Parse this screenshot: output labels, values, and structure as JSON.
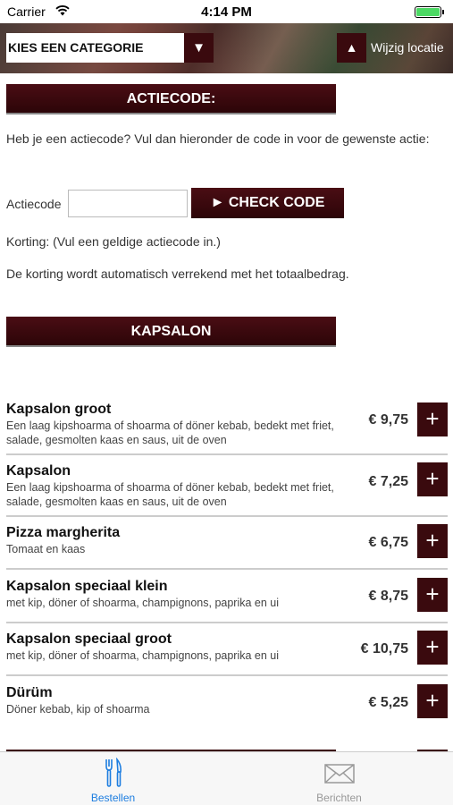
{
  "status_bar": {
    "carrier": "Carrier",
    "time": "4:14 PM"
  },
  "header": {
    "category_select": "KIES EEN CATEGORIE",
    "location_label": "Wijzig locatie"
  },
  "action_section": {
    "title": "ACTIECODE:",
    "intro": "Heb je een actiecode? Vul dan hieronder de code in voor de gewenste actie:",
    "code_label": "Actiecode",
    "code_value": "",
    "check_button": "► CHECK CODE",
    "korting": "Korting: (Vul een geldige actiecode in.)",
    "verrekend": "De korting wordt automatisch verrekend met het totaalbedrag."
  },
  "menu": {
    "title": "KAPSALON",
    "add_label": "+",
    "products": [
      {
        "name": "Kapsalon groot",
        "desc": "Een laag kipshoarma of shoarma of döner kebab, bedekt met friet, salade, gesmolten kaas en saus, uit de oven",
        "price": "€ 9,75"
      },
      {
        "name": "Kapsalon",
        "desc": "Een laag kipshoarma of shoarma of döner kebab, bedekt met friet, salade, gesmolten kaas en saus, uit de oven",
        "price": "€ 7,25"
      },
      {
        "name": "Pizza margherita",
        "desc": "Tomaat en kaas",
        "price": "€ 6,75"
      },
      {
        "name": "Kapsalon speciaal klein",
        "desc": "met kip, döner of shoarma, champignons, paprika en ui",
        "price": "€ 8,75"
      },
      {
        "name": "Kapsalon speciaal groot",
        "desc": "met kip, döner of shoarma, champignons, paprika en ui",
        "price": "€ 10,75"
      },
      {
        "name": "Dürüm",
        "desc": "Döner kebab, kip of shoarma",
        "price": "€ 5,25"
      }
    ]
  },
  "tab_bar": {
    "tabs": [
      {
        "label": "Bestellen",
        "icon": "fork-knife-icon",
        "active": true
      },
      {
        "label": "Berichten",
        "icon": "envelope-icon",
        "active": false
      }
    ]
  },
  "colors": {
    "brand_dark_red": "#3a0a0e",
    "tab_active": "#1e7ee0",
    "tab_inactive": "#999999"
  }
}
